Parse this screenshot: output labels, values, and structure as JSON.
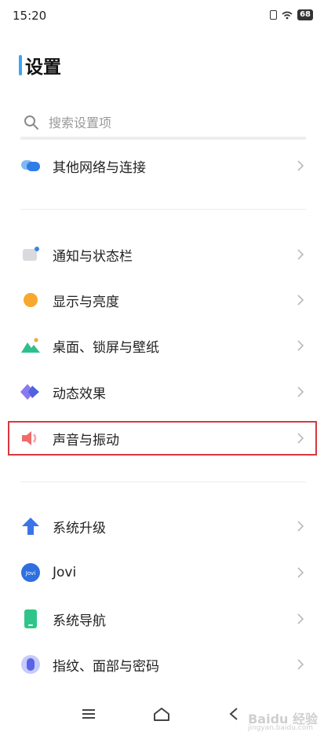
{
  "status_bar": {
    "time": "15:20",
    "battery": "68"
  },
  "header": {
    "title": "设置"
  },
  "search": {
    "placeholder": "搜索设置项"
  },
  "groups": [
    {
      "items": [
        {
          "label": "其他网络与连接",
          "icon": "network-icon"
        }
      ]
    },
    {
      "items": [
        {
          "label": "通知与状态栏",
          "icon": "notification-icon"
        },
        {
          "label": "显示与亮度",
          "icon": "brightness-icon"
        },
        {
          "label": "桌面、锁屏与壁纸",
          "icon": "wallpaper-icon"
        },
        {
          "label": "动态效果",
          "icon": "animation-icon"
        },
        {
          "label": "声音与振动",
          "icon": "speaker-icon",
          "highlighted": true
        }
      ]
    },
    {
      "items": [
        {
          "label": "系统升级",
          "icon": "upgrade-arrow-icon"
        },
        {
          "label": "Jovi",
          "icon": "jovi-icon"
        },
        {
          "label": "系统导航",
          "icon": "phone-icon"
        },
        {
          "label": "指纹、面部与密码",
          "icon": "fingerprint-icon"
        }
      ]
    }
  ],
  "watermark": {
    "brand": "Baidu 经验",
    "url": "jingyan.baidu.com"
  },
  "colors": {
    "accent": "#3aa6f0",
    "highlight": "#d9363e"
  }
}
